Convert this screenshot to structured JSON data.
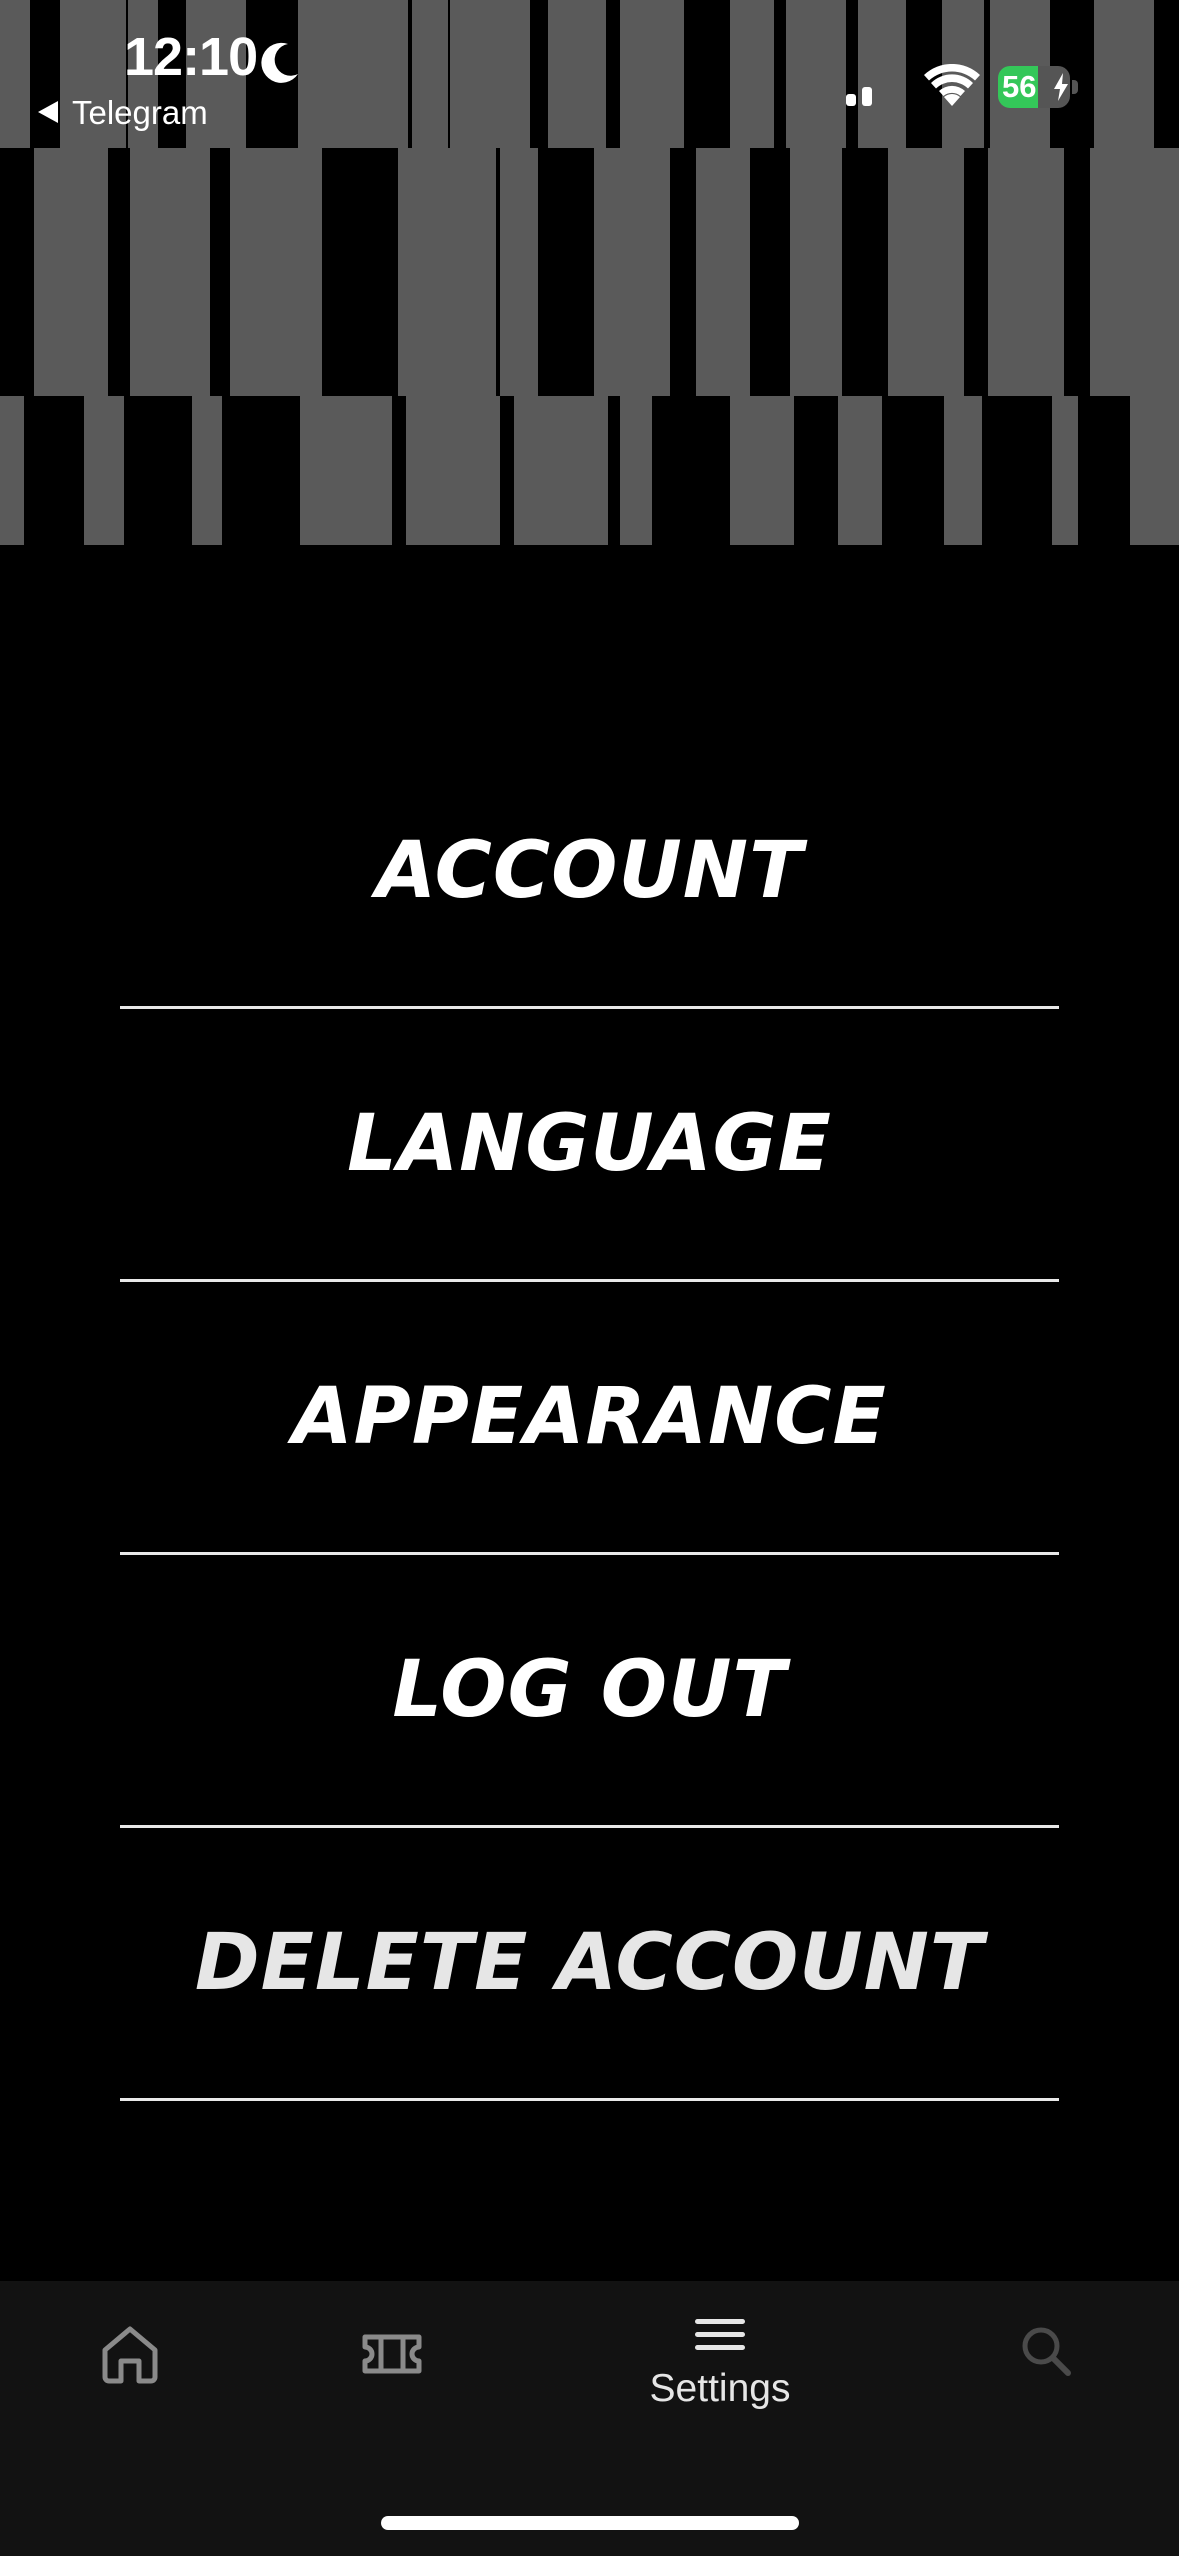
{
  "status_bar": {
    "time": "12:10",
    "back_app": "Telegram",
    "battery_level": "56",
    "battery_fraction": 0.56,
    "colors": {
      "battery": "#34c759",
      "text": "#ffffff"
    },
    "icons": [
      "moon-icon",
      "back-triangle-icon",
      "cellular-signal-icon",
      "wifi-icon",
      "battery-icon",
      "charging-bolt-icon"
    ]
  },
  "header": {
    "pattern_colors": {
      "bar": "#5a5a5a",
      "background": "#000000"
    }
  },
  "menu": {
    "items": [
      {
        "id": "account",
        "label": "ACCOUNT"
      },
      {
        "id": "language",
        "label": "LANGUAGE"
      },
      {
        "id": "appearance",
        "label": "APPEARANCE"
      },
      {
        "id": "log-out",
        "label": "LOG OUT"
      },
      {
        "id": "delete-account",
        "label": "DELETE ACCOUNT"
      }
    ]
  },
  "tab_bar": {
    "tabs": [
      {
        "id": "home",
        "icon": "home-icon",
        "label": ""
      },
      {
        "id": "tickets",
        "icon": "ticket-icon",
        "label": ""
      },
      {
        "id": "settings",
        "icon": "menu-icon",
        "label": "Settings",
        "active": true
      },
      {
        "id": "search",
        "icon": "search-icon",
        "label": ""
      }
    ],
    "colors": {
      "active": "#e6e6e6",
      "inactive": "#8a8a8a",
      "search_inactive": "#4a4a4a",
      "background": "#121212"
    }
  }
}
